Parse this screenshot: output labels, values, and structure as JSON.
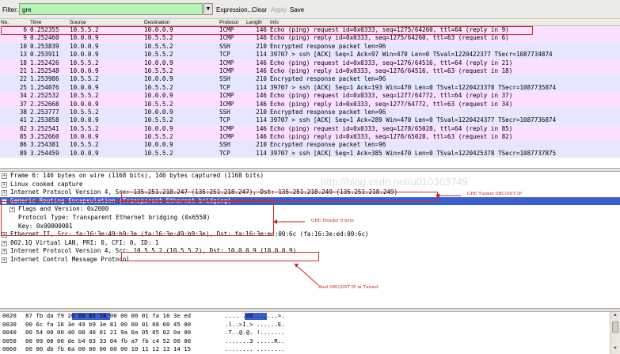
{
  "filter": {
    "label": "Filter:",
    "value": "gre",
    "expression_label": "Expression...",
    "clear_label": "Clear",
    "apply_label": "Apply",
    "save_label": "Save"
  },
  "packet_list": {
    "columns": [
      "No.",
      "Time",
      "Source",
      "Destination",
      "Protocol",
      "Length",
      "Info"
    ],
    "rows": [
      {
        "no": "6",
        "time": "0.252355",
        "src": "10.5.5.2",
        "dst": "10.0.0.9",
        "proto": "ICMP",
        "len": "146",
        "info": "Echo (ping) request  id=0x0333, seq=1275/64260, ttl=64 (reply in 9)",
        "color": "#fce0ff"
      },
      {
        "no": "9",
        "time": "0.252460",
        "src": "10.0.0.9",
        "dst": "10.5.5.2",
        "proto": "ICMP",
        "len": "146",
        "info": "Echo (ping) reply    id=0x0333, seq=1275/64260, ttl=63 (request in 6)",
        "color": "#fce0ff"
      },
      {
        "no": "10",
        "time": "0.253839",
        "src": "10.0.0.9",
        "dst": "10.5.5.2",
        "proto": "SSH",
        "len": "210",
        "info": "Encrypted response packet len=96",
        "color": "#e7e6ff"
      },
      {
        "no": "13",
        "time": "0.253911",
        "src": "10.0.0.9",
        "dst": "10.5.5.2",
        "proto": "TCP",
        "len": "114",
        "info": "39707 > ssh [ACK] Seq=1 Ack=97 Win=470 Len=0 TSval=1220422377 TSecr=1087734874",
        "color": "#e7e6ff"
      },
      {
        "no": "18",
        "time": "1.252426",
        "src": "10.5.5.2",
        "dst": "10.0.0.9",
        "proto": "ICMP",
        "len": "146",
        "info": "Echo (ping) request  id=0x0333, seq=1276/64516, ttl=64 (reply in 21)",
        "color": "#fce0ff"
      },
      {
        "no": "21",
        "time": "1.252548",
        "src": "10.0.0.9",
        "dst": "10.5.5.2",
        "proto": "ICMP",
        "len": "146",
        "info": "Echo (ping) reply    id=0x0333, seq=1276/64516, ttl=63 (request in 18)",
        "color": "#fce0ff"
      },
      {
        "no": "22",
        "time": "1.253986",
        "src": "10.5.5.2",
        "dst": "10.0.0.9",
        "proto": "SSH",
        "len": "210",
        "info": "Encrypted response packet len=96",
        "color": "#e7e6ff"
      },
      {
        "no": "25",
        "time": "1.254076",
        "src": "10.0.0.9",
        "dst": "10.5.5.2",
        "proto": "TCP",
        "len": "114",
        "info": "39707 > ssh [ACK] Seq=1 Ack=193 Win=470 Len=0 TSval=1220423378 TSecr=1087735874",
        "color": "#e7e6ff"
      },
      {
        "no": "34",
        "time": "2.252532",
        "src": "10.5.5.2",
        "dst": "10.0.0.9",
        "proto": "ICMP",
        "len": "146",
        "info": "Echo (ping) request  id=0x0333, seq=1277/64772, ttl=64 (reply in 37)",
        "color": "#fce0ff"
      },
      {
        "no": "37",
        "time": "2.252668",
        "src": "10.0.0.9",
        "dst": "10.5.5.2",
        "proto": "ICMP",
        "len": "146",
        "info": "Echo (ping) reply    id=0x0333, seq=1277/64772, ttl=63 (request in 34)",
        "color": "#fce0ff"
      },
      {
        "no": "38",
        "time": "2.253777",
        "src": "10.5.5.2",
        "dst": "10.0.0.9",
        "proto": "SSH",
        "len": "210",
        "info": "Encrypted response packet len=96",
        "color": "#e7e6ff"
      },
      {
        "no": "41",
        "time": "2.253858",
        "src": "10.0.0.9",
        "dst": "10.5.5.2",
        "proto": "TCP",
        "len": "114",
        "info": "39707 > ssh [ACK] Seq=1 Ack=289 Win=470 Len=0 TSval=1220424377 TSecr=1087736874",
        "color": "#e7e6ff"
      },
      {
        "no": "82",
        "time": "3.252541",
        "src": "10.5.5.2",
        "dst": "10.0.0.9",
        "proto": "ICMP",
        "len": "146",
        "info": "Echo (ping) request  id=0x0333, seq=1278/65028, ttl=64 (reply in 85)",
        "color": "#fce0ff"
      },
      {
        "no": "85",
        "time": "3.252660",
        "src": "10.0.0.9",
        "dst": "10.5.5.2",
        "proto": "ICMP",
        "len": "146",
        "info": "Echo (ping) reply    id=0x0333, seq=1278/65028, ttl=63 (request in 82)",
        "color": "#fce0ff"
      },
      {
        "no": "86",
        "time": "3.254381",
        "src": "10.5.5.2",
        "dst": "10.0.0.9",
        "proto": "SSH",
        "len": "210",
        "info": "Encrypted response packet len=96",
        "color": "#e7e6ff"
      },
      {
        "no": "89",
        "time": "3.254459",
        "src": "10.0.0.9",
        "dst": "10.5.5.2",
        "proto": "TCP",
        "len": "114",
        "info": "39707 > ssh [ACK] Seq=1 Ack=385 Win=470 Len=0 TSval=1220425378 TSecr=1087737875",
        "color": "#e7e6ff"
      }
    ]
  },
  "details": {
    "rows": [
      {
        "indent": 0,
        "toggle": "+",
        "text": "Frame 6: 146 bytes on wire (1168 bits), 146 bytes captured (1168 bits)"
      },
      {
        "indent": 0,
        "toggle": "+",
        "text": "Linux cooked capture"
      },
      {
        "indent": 0,
        "toggle": "+",
        "text": "Internet Protocol Version 4, Src: 135.251.218.247 (135.251.218.247), Dst: 135.251.218.249 (135.251.218.249)"
      },
      {
        "indent": 0,
        "toggle": "-",
        "text": "Generic Routing Encapsulation (Transparent Ethernet bridging)",
        "selected": true
      },
      {
        "indent": 1,
        "toggle": "+",
        "text": "Flags and Version: 0x2000"
      },
      {
        "indent": 1,
        "toggle": "",
        "text": "Protocol Type: Transparent Ethernet bridging (0x6558)"
      },
      {
        "indent": 1,
        "toggle": "",
        "text": "Key: 0x00000001"
      },
      {
        "indent": 0,
        "toggle": "+",
        "text": "Ethernet II, Src: fa:16:3e:49:b9:3e (fa:16:3e:49:b9:3e), Dst: fa:16:3e:ed:00:6c (fa:16:3e:ed:00:6c)"
      },
      {
        "indent": 0,
        "toggle": "+",
        "text": "802.1Q Virtual LAN, PRI: 0, CFI: 0, ID: 1"
      },
      {
        "indent": 0,
        "toggle": "+",
        "text": "Internet Protocol Version 4, Src: 10.5.5.2 (10.5.5.2), Dst: 10.0.0.9 (10.0.0.9)"
      },
      {
        "indent": 0,
        "toggle": "+",
        "text": "Internet Control Message Protocol"
      }
    ],
    "annotations": {
      "gre_tunnel": "GRE Tunnel SRC/DST IP",
      "gre_header": "GRE Header 8 byte",
      "real_ip_1": "Real SRC/DST IP in Tunnel"
    }
  },
  "hex_dump": {
    "rows": [
      {
        "offset": "0020",
        "bytes": "87 fb da f9 20 00 65 58  00 00 00 01 fa 16 3e ed",
        "ascii": "....  .eX ......>."
      },
      {
        "offset": "0030",
        "bytes": "00 6c fa 16 3e 49 b9 3e  81 00 00 01 08 00 45 00",
        "ascii": ".l..>I.> ......E."
      },
      {
        "offset": "0040",
        "bytes": "00 54 00 00 40 00 40 01  21 9a 0a 05 05 02 0a 00",
        "ascii": ".T..@.@. !......."
      },
      {
        "offset": "0050",
        "bytes": "00 09 08 00 de b4 03 33  04 fb a7 fb c4 52 00 00",
        "ascii": ".......3 .....R.."
      },
      {
        "offset": "0060",
        "bytes": "00 00 db fb 0a 00 00 00  00 00 10 11 12 13 14 15",
        "ascii": "........ ........"
      }
    ]
  },
  "watermark": "http://blog.csdn.net/u010363749",
  "colors": {
    "icmp_row": "#fce0ff",
    "ssh_tcp_row": "#e7e6ff",
    "selection": "#3a5fcd",
    "filter_valid": "#b6f5b6",
    "annotation": "#c81e1e"
  }
}
